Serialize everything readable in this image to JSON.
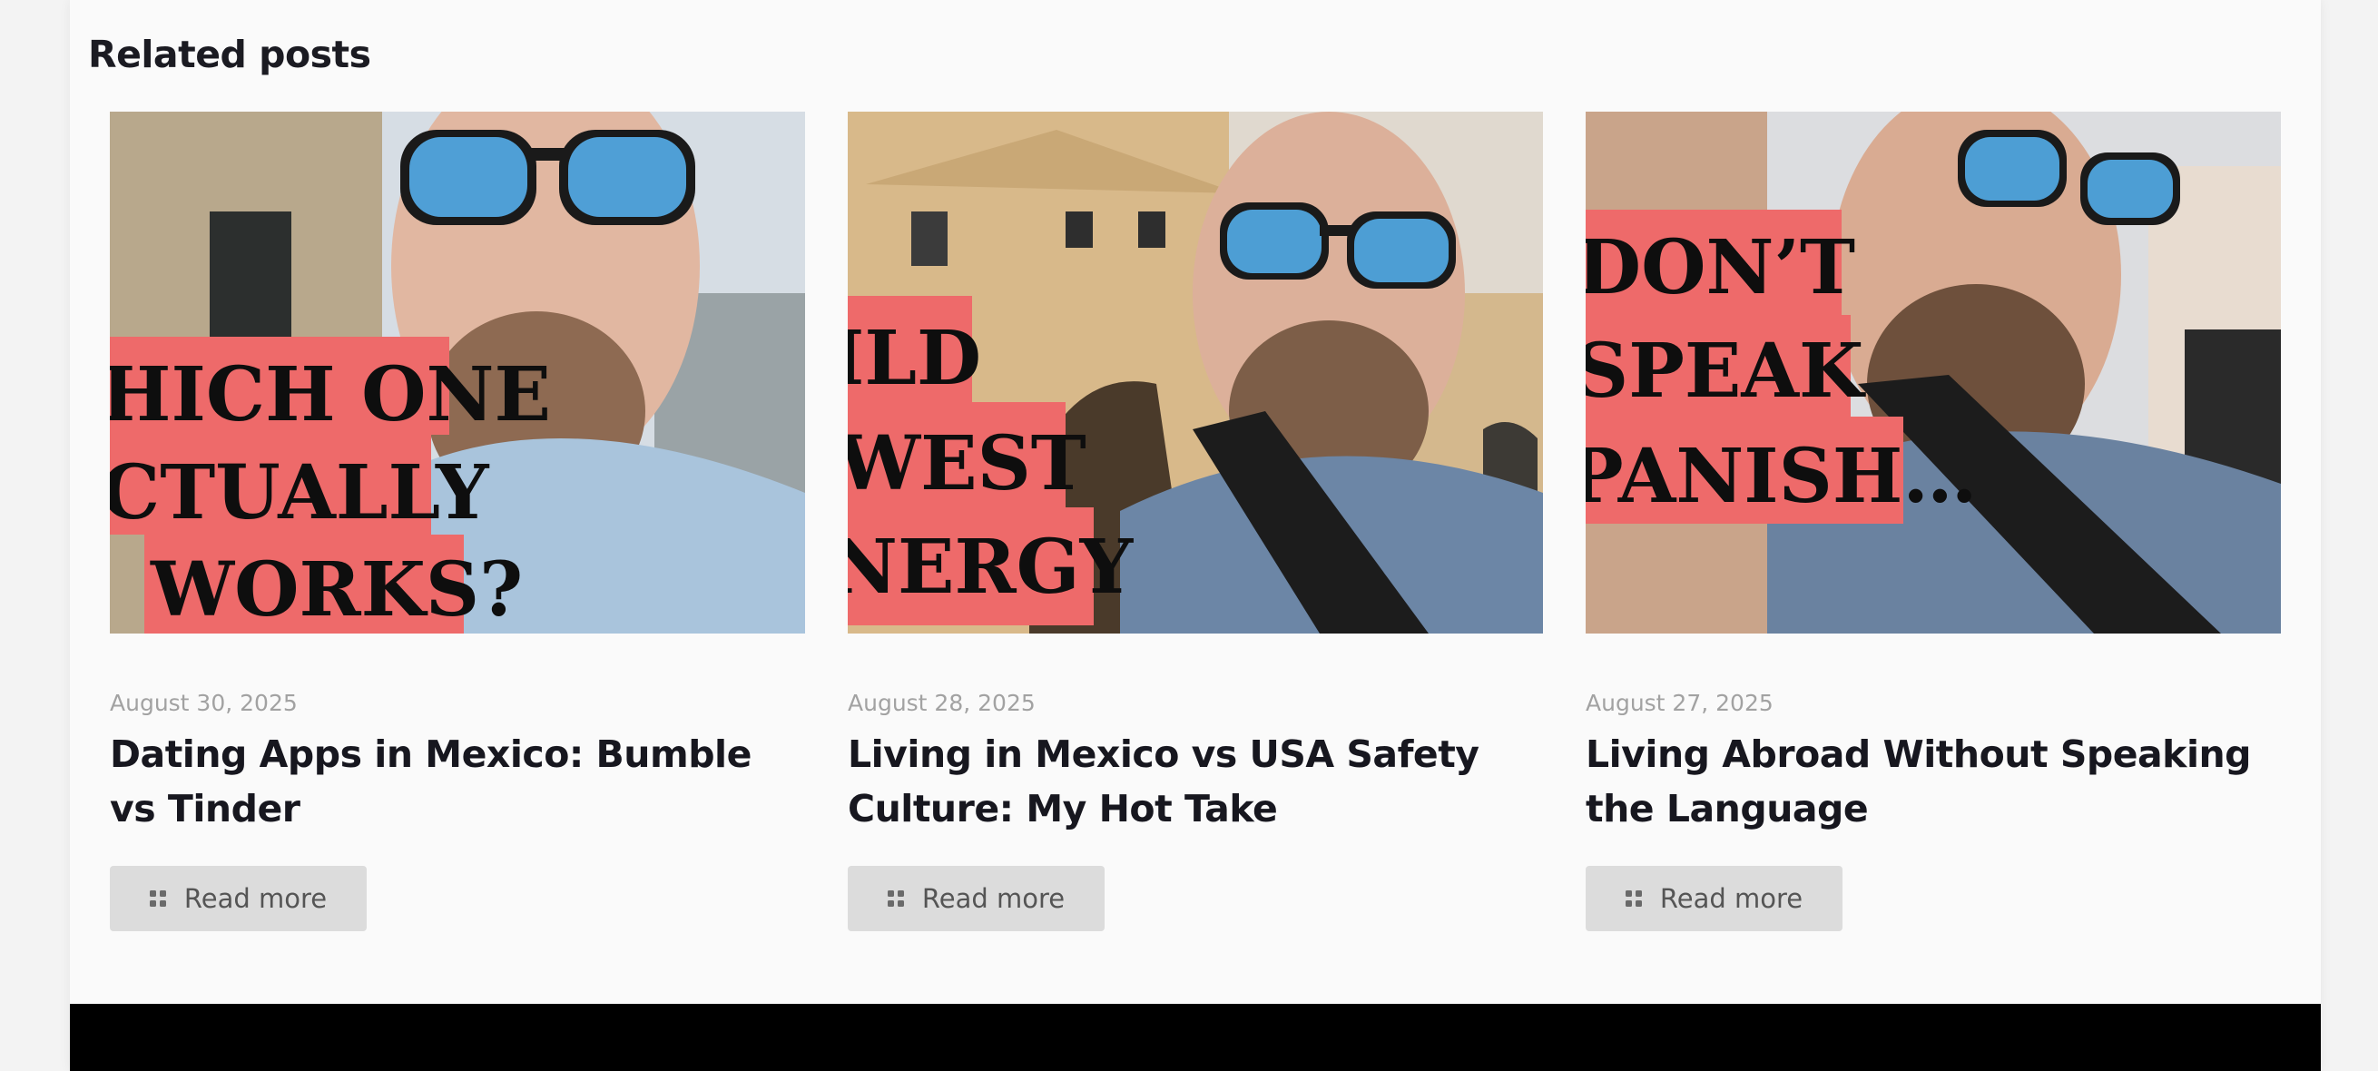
{
  "section": {
    "title": "Related posts"
  },
  "posts": [
    {
      "date": "August 30, 2025",
      "title": "Dating Apps in Mexico: Bumble vs Tinder",
      "read_more": "Read more",
      "thumbnail_text": [
        "HICH ONE",
        "CTUALLY",
        "WORKS?"
      ]
    },
    {
      "date": "August 28, 2025",
      "title": "Living in Mexico vs USA Safety Culture: My Hot Take",
      "read_more": "Read more",
      "thumbnail_text": [
        "ILD",
        "WEST",
        "NERGY"
      ]
    },
    {
      "date": "August 27, 2025",
      "title": "Living Abroad Without Speaking the Language",
      "read_more": "Read more",
      "thumbnail_text": [
        "DON’T",
        "SPEAK",
        "PANISH…"
      ]
    }
  ],
  "colors": {
    "overlay": "#ee6a6a",
    "button_bg": "#dcdcdc",
    "footer": "#000000"
  }
}
